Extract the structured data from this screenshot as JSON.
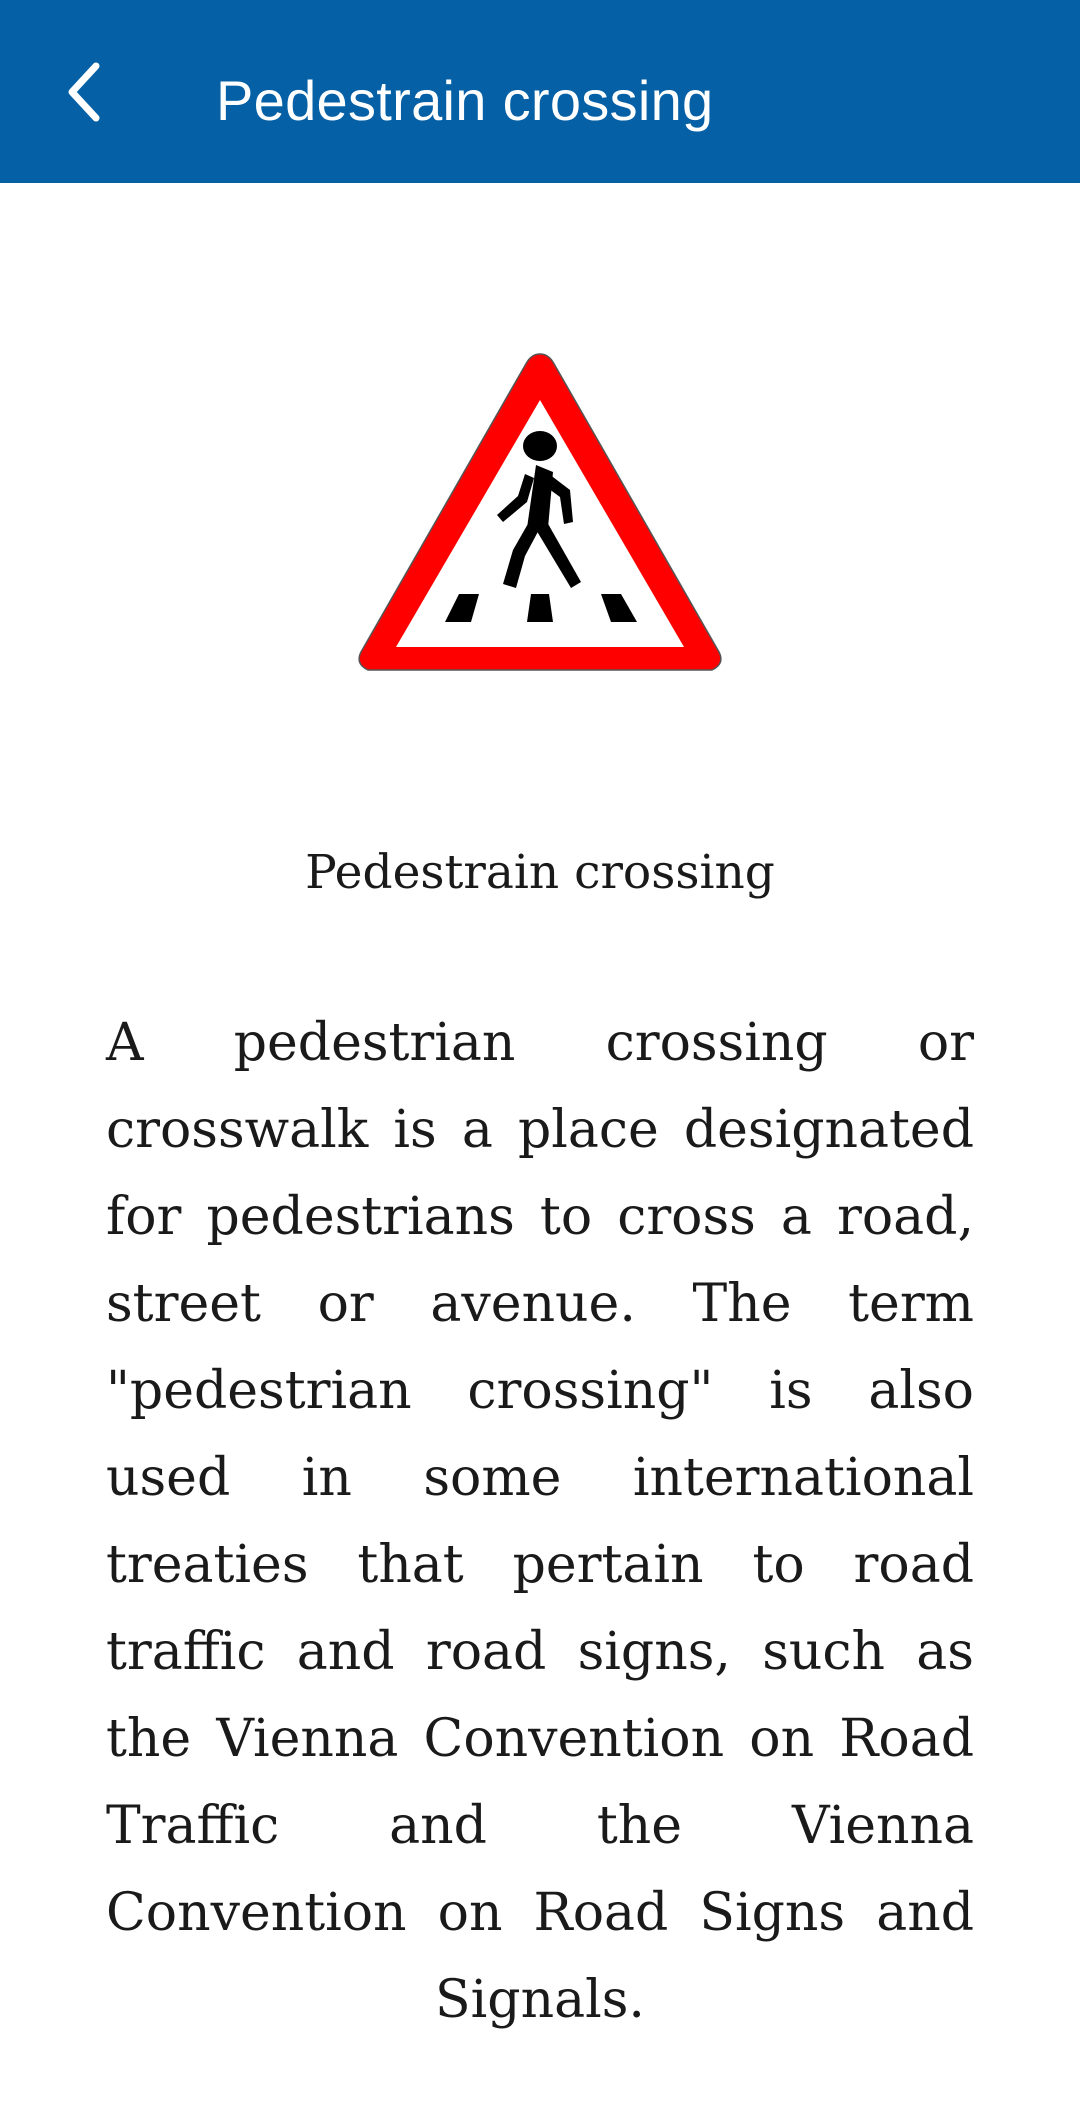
{
  "app_bar": {
    "title": "Pedestrain crossing",
    "background_color": "#0560A6",
    "back_icon": "chevron-left-icon"
  },
  "sign": {
    "icon": "pedestrian-crossing-warning-sign",
    "border_color": "#FF0000",
    "fill_color": "#FFFFFF",
    "figure_color": "#000000"
  },
  "content": {
    "caption": "Pedestrain crossing",
    "description": "A pedestrian crossing or crosswalk is a place designated for pedestrians to cross a road, street or avenue. The term \"pedestrian crossing\" is also used in some international treaties that pertain to road traffic and road signs, such as the Vienna Convention on Road Traffic and the Vienna Convention on Road Signs and Signals."
  }
}
